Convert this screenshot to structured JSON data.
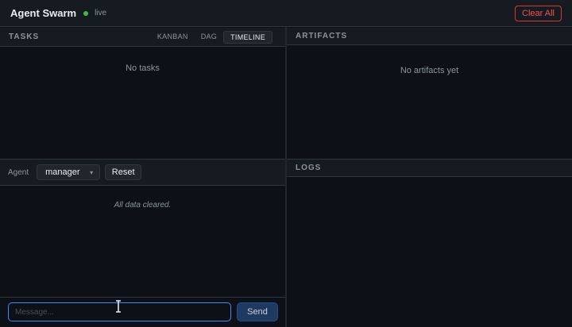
{
  "header": {
    "title": "Agent Swarm",
    "status": "live",
    "status_color": "#3fb950",
    "clear_label": "Clear All"
  },
  "tasks": {
    "title": "TASKS",
    "tabs": [
      {
        "label": "KANBAN",
        "active": false
      },
      {
        "label": "DAG",
        "active": false
      },
      {
        "label": "TIMELINE",
        "active": true
      }
    ],
    "empty": "No tasks"
  },
  "artifacts": {
    "title": "ARTIFACTS",
    "empty": "No artifacts yet"
  },
  "chat": {
    "agent_label": "Agent",
    "agent_value": "manager",
    "reset_label": "Reset",
    "message": "All data cleared.",
    "input_placeholder": "Message...",
    "send_label": "Send"
  },
  "logs": {
    "title": "LOGS"
  },
  "colors": {
    "background": "#0d1117",
    "panel_header": "#161b22",
    "accent": "#388bfd",
    "danger": "#f85149"
  },
  "icons": {
    "status": "live-dot-icon",
    "dropdown": "chevron-down-icon",
    "cursor": "text-cursor-icon"
  }
}
